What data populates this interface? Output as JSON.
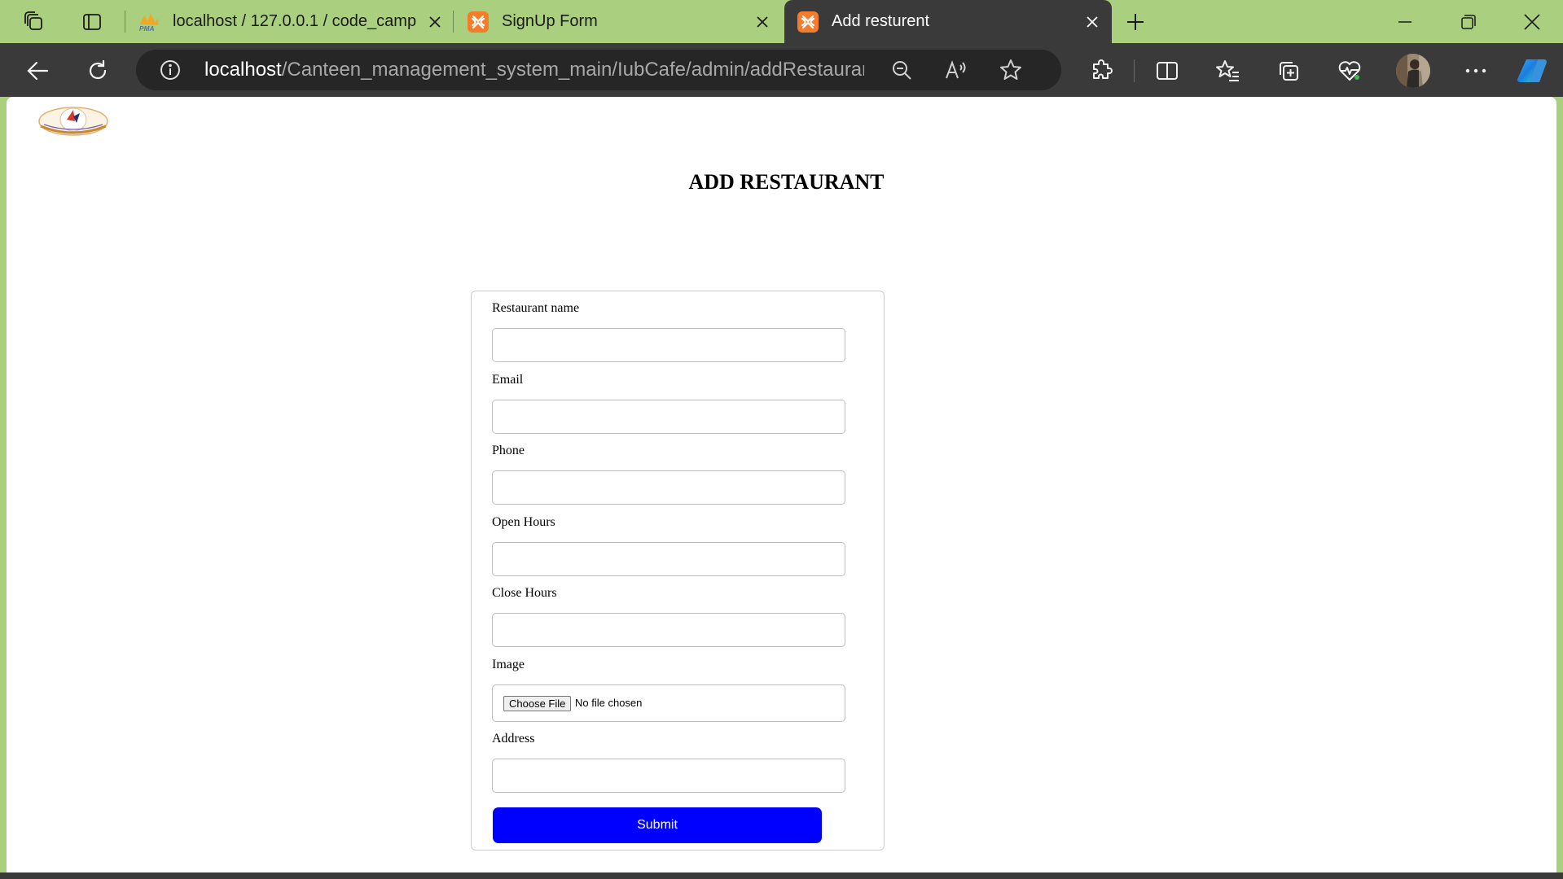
{
  "browser": {
    "tabs": [
      {
        "title": "localhost / 127.0.0.1 / code_camp",
        "favicon": "phpmyadmin-icon",
        "favicon_text": "PMA",
        "active": false
      },
      {
        "title": "SignUp Form",
        "favicon": "xampp-icon",
        "active": false
      },
      {
        "title": "Add resturent",
        "favicon": "xampp-icon",
        "active": true
      }
    ],
    "address": {
      "host": "localhost",
      "path": "/Canteen_management_system_main/IubCafe/admin/addRestaurant.p..."
    },
    "colors": {
      "tabstrip": "#a9cf7f",
      "toolbar": "#3a3a3a",
      "favicon_orange": "#f47c2a"
    }
  },
  "page": {
    "title": "ADD RESTAURANT",
    "form": {
      "fields": [
        {
          "label": "Restaurant name",
          "value": ""
        },
        {
          "label": "Email",
          "value": ""
        },
        {
          "label": "Phone",
          "value": ""
        },
        {
          "label": "Open Hours",
          "value": ""
        },
        {
          "label": "Close Hours",
          "value": ""
        },
        {
          "label": "Image",
          "type": "file",
          "button": "Choose File",
          "status": "No file chosen"
        },
        {
          "label": "Address",
          "value": ""
        }
      ],
      "submit_label": "Submit",
      "submit_color": "#0000ff"
    }
  }
}
